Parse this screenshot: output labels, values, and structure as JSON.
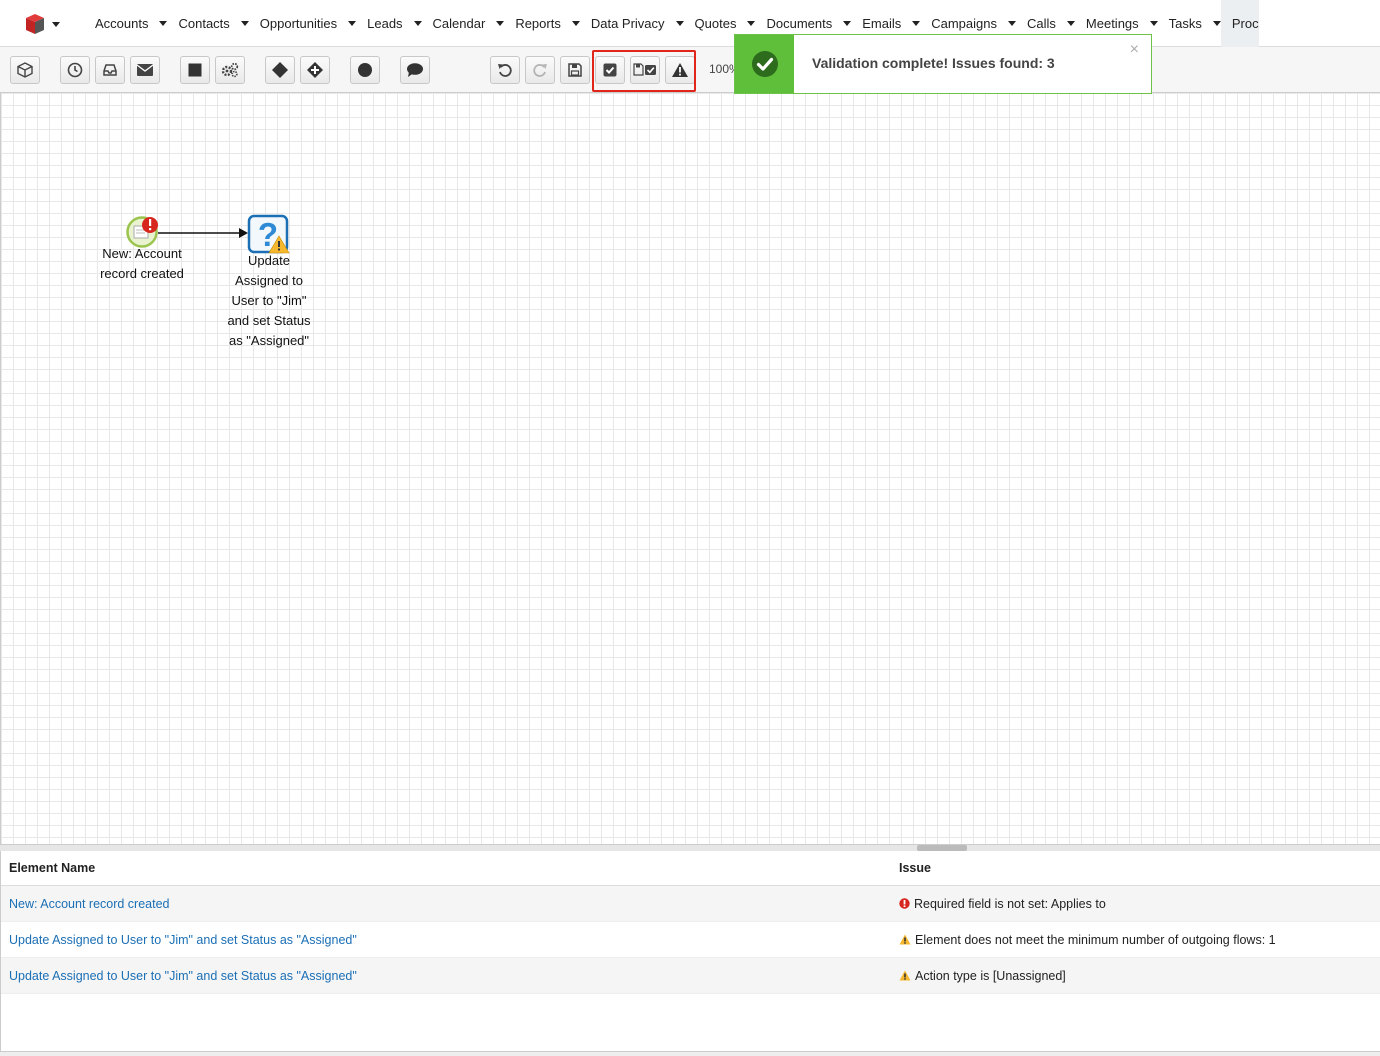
{
  "nav": {
    "items": [
      {
        "label": "Accounts"
      },
      {
        "label": "Contacts"
      },
      {
        "label": "Opportunities"
      },
      {
        "label": "Leads"
      },
      {
        "label": "Calendar"
      },
      {
        "label": "Reports"
      },
      {
        "label": "Data Privacy"
      },
      {
        "label": "Quotes"
      },
      {
        "label": "Documents"
      },
      {
        "label": "Emails"
      },
      {
        "label": "Campaigns"
      },
      {
        "label": "Calls"
      },
      {
        "label": "Meetings"
      },
      {
        "label": "Tasks"
      }
    ],
    "overflow_label": "Proc"
  },
  "toolbar": {
    "zoom": "100%",
    "buttons": [
      "cube-icon",
      "clock-icon",
      "inbox-icon",
      "envelope-icon",
      "square-icon",
      "gears-icon",
      "diamond-icon",
      "diamond-plus-icon",
      "circle-icon",
      "comment-icon",
      "undo-icon",
      "redo-icon",
      "save-icon",
      "validate-icon",
      "save-validate-icon",
      "warning-icon"
    ]
  },
  "toast": {
    "message": "Validation complete! Issues found: 3",
    "close": "×",
    "color": "#5fbf3b"
  },
  "canvas": {
    "start_label_1": "New: Account",
    "start_label_2": "record created",
    "action_label": [
      "Update",
      "Assigned to",
      "User to \"Jim\"",
      "and set Status",
      "as \"Assigned\""
    ]
  },
  "issues": {
    "headers": {
      "element": "Element Name",
      "issue": "Issue"
    },
    "rows": [
      {
        "element": "New: Account record created",
        "issue": "Required field is not set: Applies to",
        "severity": "error"
      },
      {
        "element": "Update Assigned to User to \"Jim\" and set Status as \"Assigned\"",
        "issue": "Element does not meet the minimum number of outgoing flows: 1",
        "severity": "warning"
      },
      {
        "element": "Update Assigned to User to \"Jim\" and set Status as \"Assigned\"",
        "issue": "Action type is [Unassigned]",
        "severity": "warning"
      }
    ]
  }
}
